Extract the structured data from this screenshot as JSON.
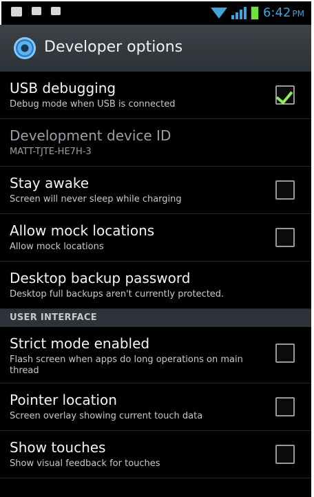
{
  "status_bar": {
    "time": "6:42",
    "ampm": "PM",
    "icons": [
      "image-icon",
      "message-icon",
      "briefcase-icon",
      "wifi-icon",
      "signal-icon",
      "battery-icon"
    ]
  },
  "header": {
    "title": "Developer options",
    "icon": "settings-gear-icon"
  },
  "items": [
    {
      "title": "USB debugging",
      "summary": "Debug mode when USB is connected",
      "checked": true,
      "has_checkbox": true
    },
    {
      "title": "Development device ID",
      "summary": "MATT-TJTE-HE7H-3",
      "has_checkbox": false
    },
    {
      "title": "Stay awake",
      "summary": "Screen will never sleep while charging",
      "checked": false,
      "has_checkbox": true
    },
    {
      "title": "Allow mock locations",
      "summary": "Allow mock locations",
      "checked": false,
      "has_checkbox": true
    },
    {
      "title": "Desktop backup password",
      "summary": "Desktop full backups aren't currently protected.",
      "has_checkbox": false
    }
  ],
  "section_user_interface": "USER INTERFACE",
  "ui_items": [
    {
      "title": "Strict mode enabled",
      "summary": "Flash screen when apps do long operations on main thread",
      "checked": false
    },
    {
      "title": "Pointer location",
      "summary": "Screen overlay showing current touch data",
      "checked": false
    },
    {
      "title": "Show touches",
      "summary": "Show visual feedback for touches",
      "checked": false
    }
  ],
  "colors": {
    "accent": "#3ea6d8",
    "check": "#8df04b",
    "section_bg": "#2e3339"
  }
}
